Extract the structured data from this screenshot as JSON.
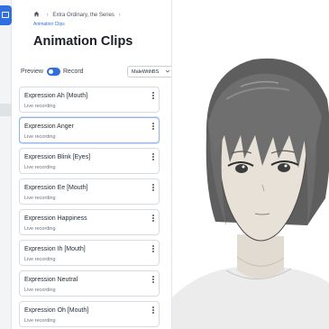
{
  "breadcrumb": {
    "items": [
      "Extra Ordinary, the Series"
    ],
    "current": "Animation Clips"
  },
  "page": {
    "title": "Animation Clips"
  },
  "toolbar": {
    "preview_label": "Preview",
    "record_label": "Record",
    "mode": "preview",
    "model_select": {
      "value": "MaleWithBS"
    }
  },
  "clips": [
    {
      "name": "Expression Ah [Mouth]",
      "status": "Live recording"
    },
    {
      "name": "Expression Anger",
      "status": "Live recording",
      "selected": true
    },
    {
      "name": "Expression Blink [Eyes]",
      "status": "Live recording"
    },
    {
      "name": "Expression Ee [Mouth]",
      "status": "Live recording"
    },
    {
      "name": "Expression Happiness",
      "status": "Live recording"
    },
    {
      "name": "Expression Ih [Mouth]",
      "status": "Live recording"
    },
    {
      "name": "Expression Neutral",
      "status": "Live recording"
    },
    {
      "name": "Expression Oh [Mouth]",
      "status": "Live recording"
    }
  ],
  "icons": {
    "app_logo": "app-logo-icon",
    "home": "home-icon",
    "breadcrumb_separator": "chevron-right-icon",
    "select": "chevron-down-icon",
    "card_menu": "kebab-menu-icon"
  },
  "colors": {
    "accent": "#2f6fe0",
    "card_border": "#d7dce2",
    "selected_border": "#8fb4ee",
    "hair": "#6d6d6d",
    "skin": "#e8e1d7"
  }
}
